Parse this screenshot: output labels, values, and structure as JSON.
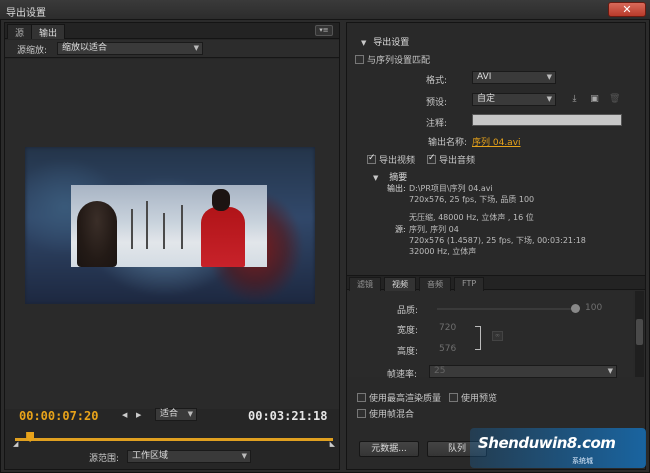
{
  "window": {
    "title": "导出设置",
    "close_label": "✕"
  },
  "left": {
    "tabs": [
      {
        "label": "源"
      },
      {
        "label": "输出"
      }
    ],
    "panel_menu_glyph": "▾≡",
    "source_scale_label": "源缩放:",
    "source_scale_value": "缩放以适合",
    "current_time": "00:00:07:20",
    "fit_value": "适合",
    "duration": "00:03:21:18",
    "source_range_label": "源范围:",
    "source_range_value": "工作区域",
    "playhead_fraction": 0.035
  },
  "export_settings": {
    "header": "导出设置",
    "match_sequence_label": "与序列设置匹配",
    "match_sequence_checked": false,
    "format_label": "格式:",
    "format_value": "AVI",
    "preset_label": "预设:",
    "preset_value": "自定",
    "comment_label": "注释:",
    "comment_value": "",
    "output_name_label": "输出名称:",
    "output_name_value": "序列 04.avi",
    "export_video_label": "导出视频",
    "export_video_checked": true,
    "export_audio_label": "导出音频",
    "export_audio_checked": true,
    "summary_header": "摘要",
    "output_label": "输出:",
    "output_lines": [
      "D:\\PR项目\\序列 04.avi",
      "720x576, 25 fps, 下场, 品质 100",
      "无压缩, 48000 Hz, 立体声 , 16 位"
    ],
    "source_label": "源:",
    "source_lines": [
      "序列, 序列 04",
      "720x576 (1.4587), 25 fps, 下场, 00:03:21:18",
      "32000 Hz, 立体声"
    ]
  },
  "settings_tabs": [
    {
      "label": "滤镜"
    },
    {
      "label": "视频"
    },
    {
      "label": "音频"
    },
    {
      "label": "FTP"
    }
  ],
  "video": {
    "quality_label": "品质:",
    "quality_value": "100",
    "width_label": "宽度:",
    "width_value": "720",
    "height_label": "高度:",
    "height_value": "576",
    "framerate_label": "帧速率:",
    "framerate_value": "25"
  },
  "options": {
    "max_render_quality_label": "使用最高渲染质量",
    "max_render_quality_checked": false,
    "use_preview_label": "使用预览",
    "use_preview_checked": false,
    "frame_blend_label": "使用帧混合",
    "frame_blend_checked": false
  },
  "buttons": {
    "metadata_label": "元数据...",
    "queue_label": "队列"
  },
  "watermark": {
    "text": "Shenduwin8.com",
    "sub": "系统城"
  },
  "colors": {
    "accent": "#e8a31a",
    "background": "#2b2b2b"
  }
}
